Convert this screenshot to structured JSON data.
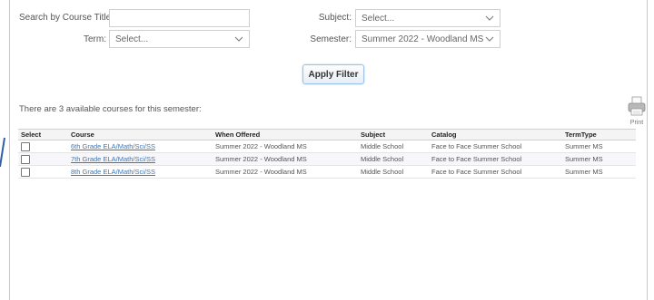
{
  "filters": {
    "course_title_label": "Search by Course Title:",
    "course_title_value": "",
    "term_label": "Term:",
    "term_value": "Select...",
    "subject_label": "Subject:",
    "subject_value": "Select...",
    "semester_label": "Semester:",
    "semester_value": "Summer 2022 - Woodland MS",
    "apply_label": "Apply Filter"
  },
  "results": {
    "summary": "There are 3 available courses for this semester:",
    "print_label": "Print"
  },
  "table": {
    "columns": [
      "Select",
      "Course",
      "When Offered",
      "Subject",
      "Catalog",
      "TermType"
    ],
    "rows": [
      {
        "course": "6th Grade ELA/Math/Sci/SS",
        "when": "Summer 2022 - Woodland MS",
        "subject": "Middle School",
        "catalog": "Face to Face Summer School",
        "termtype": "Summer MS",
        "checked": false
      },
      {
        "course": "7th Grade ELA/Math/Sci/SS",
        "when": "Summer 2022 - Woodland MS",
        "subject": "Middle School",
        "catalog": "Face to Face Summer School",
        "termtype": "Summer MS",
        "checked": false
      },
      {
        "course": "8th Grade ELA/Math/Sci/SS",
        "when": "Summer 2022 - Woodland MS",
        "subject": "Middle School",
        "catalog": "Face to Face Summer School",
        "termtype": "Summer MS",
        "checked": false
      }
    ]
  },
  "colors": {
    "link": "#3a77b8",
    "button_border": "#9fc2e6"
  }
}
